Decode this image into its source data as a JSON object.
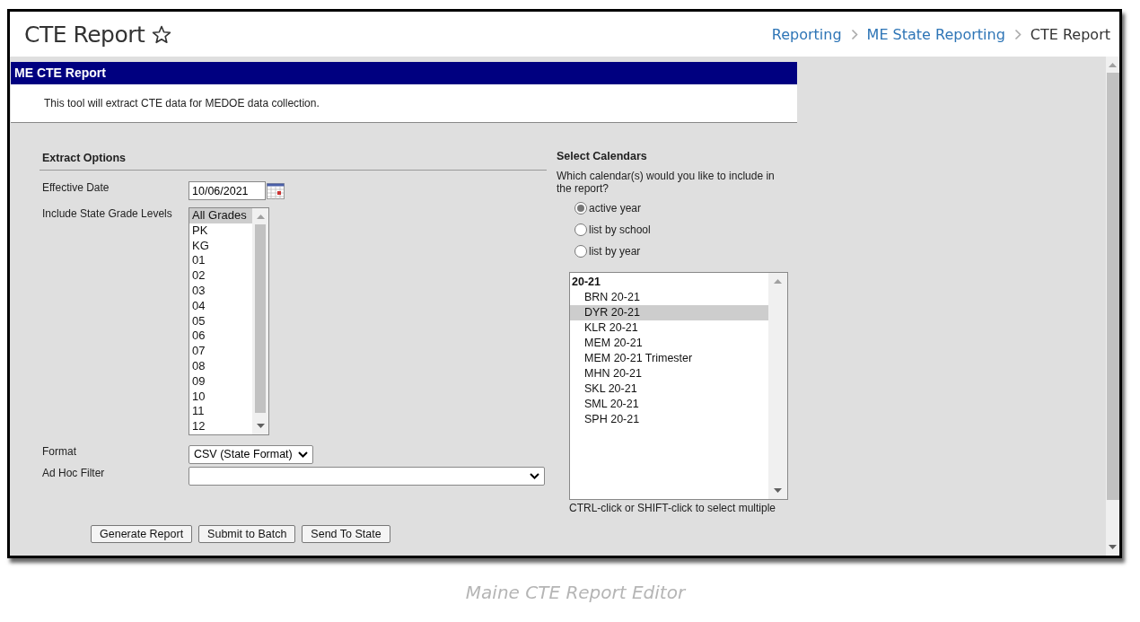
{
  "page": {
    "title": "CTE Report"
  },
  "breadcrumb": [
    {
      "label": "Reporting",
      "kind": "link"
    },
    {
      "label": "ME State Reporting",
      "kind": "link"
    },
    {
      "label": "CTE Report",
      "kind": "current"
    }
  ],
  "report": {
    "title": "ME CTE Report",
    "description": "This tool will extract CTE data for MEDOE data collection."
  },
  "extract_options": {
    "heading": "Extract Options",
    "effective_date": {
      "label": "Effective Date",
      "value": "10/06/2021"
    },
    "grade_levels": {
      "label": "Include State Grade Levels",
      "options": [
        {
          "label": "All Grades",
          "selected": true
        },
        {
          "label": "PK",
          "selected": false
        },
        {
          "label": "KG",
          "selected": false
        },
        {
          "label": "01",
          "selected": false
        },
        {
          "label": "02",
          "selected": false
        },
        {
          "label": "03",
          "selected": false
        },
        {
          "label": "04",
          "selected": false
        },
        {
          "label": "05",
          "selected": false
        },
        {
          "label": "06",
          "selected": false
        },
        {
          "label": "07",
          "selected": false
        },
        {
          "label": "08",
          "selected": false
        },
        {
          "label": "09",
          "selected": false
        },
        {
          "label": "10",
          "selected": false
        },
        {
          "label": "11",
          "selected": false
        },
        {
          "label": "12",
          "selected": false
        }
      ]
    },
    "format": {
      "label": "Format",
      "value": "CSV (State Format)"
    },
    "ad_hoc_filter": {
      "label": "Ad Hoc Filter"
    }
  },
  "buttons": [
    "Generate Report",
    "Submit to Batch",
    "Send To State"
  ],
  "select_calendars": {
    "heading": "Select Calendars",
    "question": "Which calendar(s) would you like to include in the report?",
    "modes": [
      {
        "label": "active year",
        "selected": true
      },
      {
        "label": "list by school",
        "selected": false
      },
      {
        "label": "list by year",
        "selected": false
      }
    ],
    "groups": [
      {
        "label": "20-21",
        "children": [
          {
            "label": "BRN 20-21",
            "selected": false
          },
          {
            "label": "DYR 20-21",
            "selected": true
          },
          {
            "label": "KLR 20-21",
            "selected": false
          },
          {
            "label": "MEM 20-21",
            "selected": false
          },
          {
            "label": "MEM 20-21 Trimester",
            "selected": false
          },
          {
            "label": "MHN 20-21",
            "selected": false
          },
          {
            "label": "SKL 20-21",
            "selected": false
          },
          {
            "label": "SML 20-21",
            "selected": false
          },
          {
            "label": "SPH 20-21",
            "selected": false
          }
        ]
      }
    ],
    "hint": "CTRL-click or SHIFT-click to select multiple"
  },
  "caption": "Maine CTE Report Editor"
}
